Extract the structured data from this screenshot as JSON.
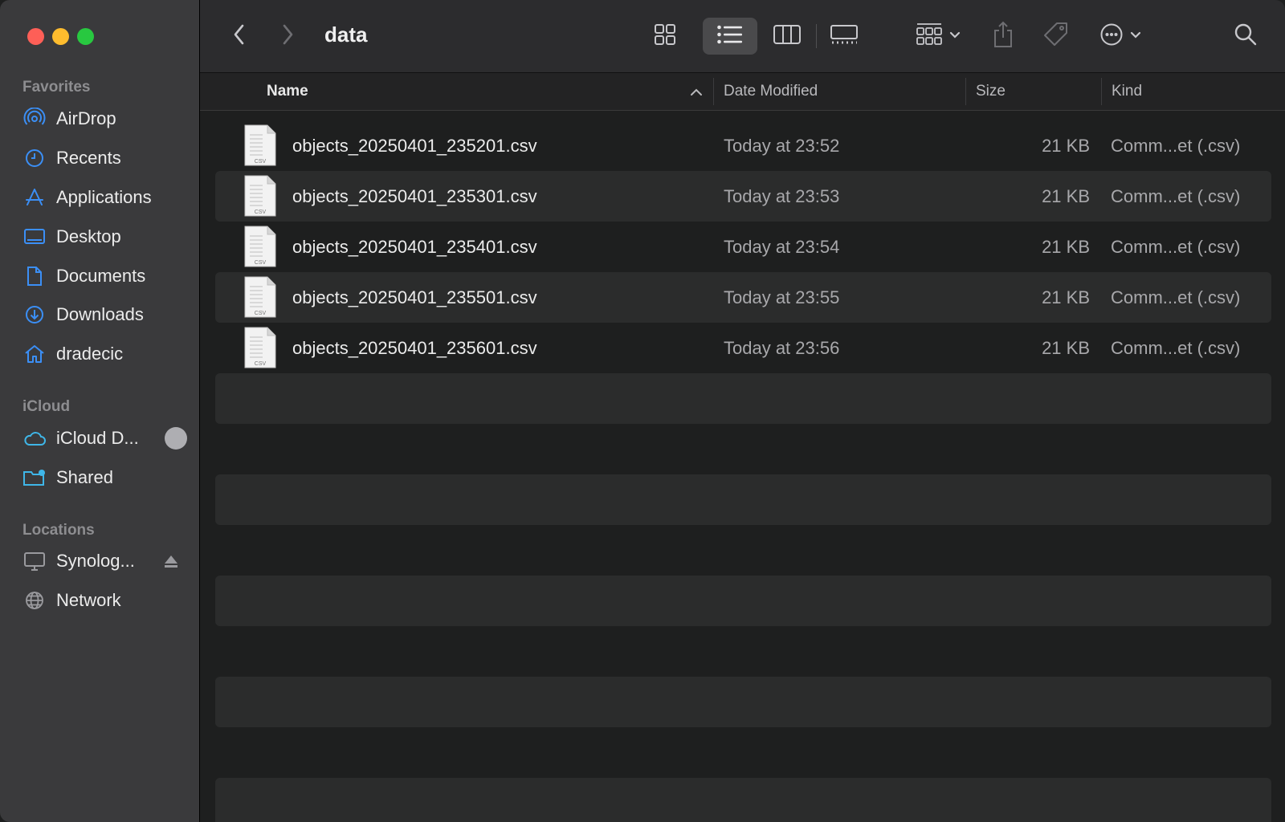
{
  "window": {
    "title": "data"
  },
  "sidebar": {
    "sections": [
      {
        "label": "Favorites",
        "items": [
          {
            "label": "AirDrop",
            "icon": "airdrop-icon"
          },
          {
            "label": "Recents",
            "icon": "clock-icon"
          },
          {
            "label": "Applications",
            "icon": "applications-icon"
          },
          {
            "label": "Desktop",
            "icon": "desktop-icon"
          },
          {
            "label": "Documents",
            "icon": "document-icon"
          },
          {
            "label": "Downloads",
            "icon": "download-icon"
          },
          {
            "label": "dradecic",
            "icon": "home-icon"
          }
        ]
      },
      {
        "label": "iCloud",
        "items": [
          {
            "label": "iCloud D...",
            "icon": "cloud-icon"
          },
          {
            "label": "Shared",
            "icon": "shared-folder-icon"
          }
        ]
      },
      {
        "label": "Locations",
        "items": [
          {
            "label": "Synolog...",
            "icon": "computer-icon"
          },
          {
            "label": "Network",
            "icon": "globe-icon"
          }
        ]
      }
    ]
  },
  "columns": {
    "name": "Name",
    "date": "Date Modified",
    "size": "Size",
    "kind": "Kind"
  },
  "files": [
    {
      "name": "objects_20250401_235201.csv",
      "date": "Today at 23:52",
      "size": "21 KB",
      "kind": "Comm...et (.csv)",
      "icon_text": "CSV"
    },
    {
      "name": "objects_20250401_235301.csv",
      "date": "Today at 23:53",
      "size": "21 KB",
      "kind": "Comm...et (.csv)",
      "icon_text": "CSV"
    },
    {
      "name": "objects_20250401_235401.csv",
      "date": "Today at 23:54",
      "size": "21 KB",
      "kind": "Comm...et (.csv)",
      "icon_text": "CSV"
    },
    {
      "name": "objects_20250401_235501.csv",
      "date": "Today at 23:55",
      "size": "21 KB",
      "kind": "Comm...et (.csv)",
      "icon_text": "CSV"
    },
    {
      "name": "objects_20250401_235601.csv",
      "date": "Today at 23:56",
      "size": "21 KB",
      "kind": "Comm...et (.csv)",
      "icon_text": "CSV"
    }
  ],
  "colors": {
    "accent": "#3b8ff6",
    "sidebar_bg": "#3a3a3c",
    "content_bg": "#1e1f1f",
    "row_alt": "#2b2c2c"
  }
}
